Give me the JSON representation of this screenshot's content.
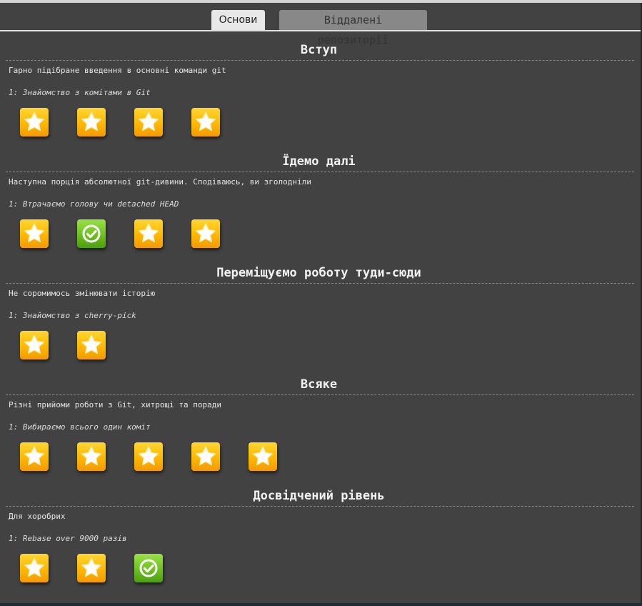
{
  "tabs": [
    {
      "label": "Основи",
      "active": true
    },
    {
      "label": "Віддалені репозиторії",
      "active": false
    }
  ],
  "sections": [
    {
      "title": "Вступ",
      "description": "Гарно підібране введення в основні команди git",
      "level_name": "1: Знайомство з комітами в Git",
      "levels": [
        "star-icon",
        "star-icon",
        "star-icon",
        "star-icon"
      ]
    },
    {
      "title": "Їдемо далі",
      "description": "Наступна порція абсолютної git-дивини. Сподіваюсь, ви зголодніли",
      "level_name": "1: Втрачаємо голову чи detached HEAD",
      "levels": [
        "star-icon",
        "check-icon",
        "star-icon",
        "star-icon"
      ]
    },
    {
      "title": "Переміщуємо роботу туди-сюди",
      "description": "Не соромимось змінювати історію",
      "level_name": "1: Знайомство з cherry-pick",
      "levels": [
        "star-icon",
        "star-icon"
      ]
    },
    {
      "title": "Всяке",
      "description": "Різні прийоми роботи з Git, хитрощі та поради",
      "level_name": "1: Вибираємо всього один коміт",
      "levels": [
        "star-icon",
        "star-icon",
        "star-icon",
        "star-icon",
        "star-icon"
      ]
    },
    {
      "title": "Досвідчений рівень",
      "description": "Для хоробрих",
      "level_name": "1: Rebase over 9000 разів",
      "levels": [
        "star-icon",
        "star-icon",
        "check-icon"
      ]
    }
  ],
  "colors": {
    "star_gold": "#ffb800",
    "solved_green": "#6cc21d",
    "panel_bg": "#424242"
  }
}
